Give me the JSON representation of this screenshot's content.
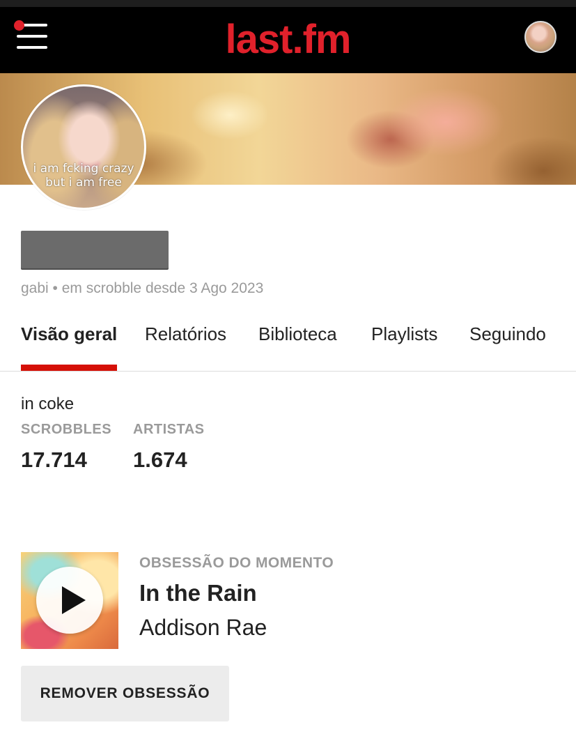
{
  "header": {
    "logo_text": "last.fm",
    "logo_color": "#e0212b",
    "menu_icon": "hamburger-menu-icon",
    "notification_dot_color": "#e0212b"
  },
  "profile": {
    "avatar_caption_line1": "i am fcking crazy",
    "avatar_caption_line2": "but i am free",
    "subline": "gabi • em scrobble desde 3 Ago 2023",
    "bio": "in coke"
  },
  "tabs": [
    {
      "label": "Visão geral",
      "active": true
    },
    {
      "label": "Relatórios",
      "active": false
    },
    {
      "label": "Biblioteca",
      "active": false
    },
    {
      "label": "Playlists",
      "active": false
    },
    {
      "label": "Seguindo",
      "active": false
    }
  ],
  "accent_color": "#d51007",
  "stats": [
    {
      "label": "SCROBBLES",
      "value": "17.714"
    },
    {
      "label": "ARTISTAS",
      "value": "1.674"
    }
  ],
  "obsession": {
    "label": "OBSESSÃO DO MOMENTO",
    "track": "In the Rain",
    "artist": "Addison Rae",
    "play_icon": "play-icon",
    "remove_button": "REMOVER OBSESSÃO"
  }
}
